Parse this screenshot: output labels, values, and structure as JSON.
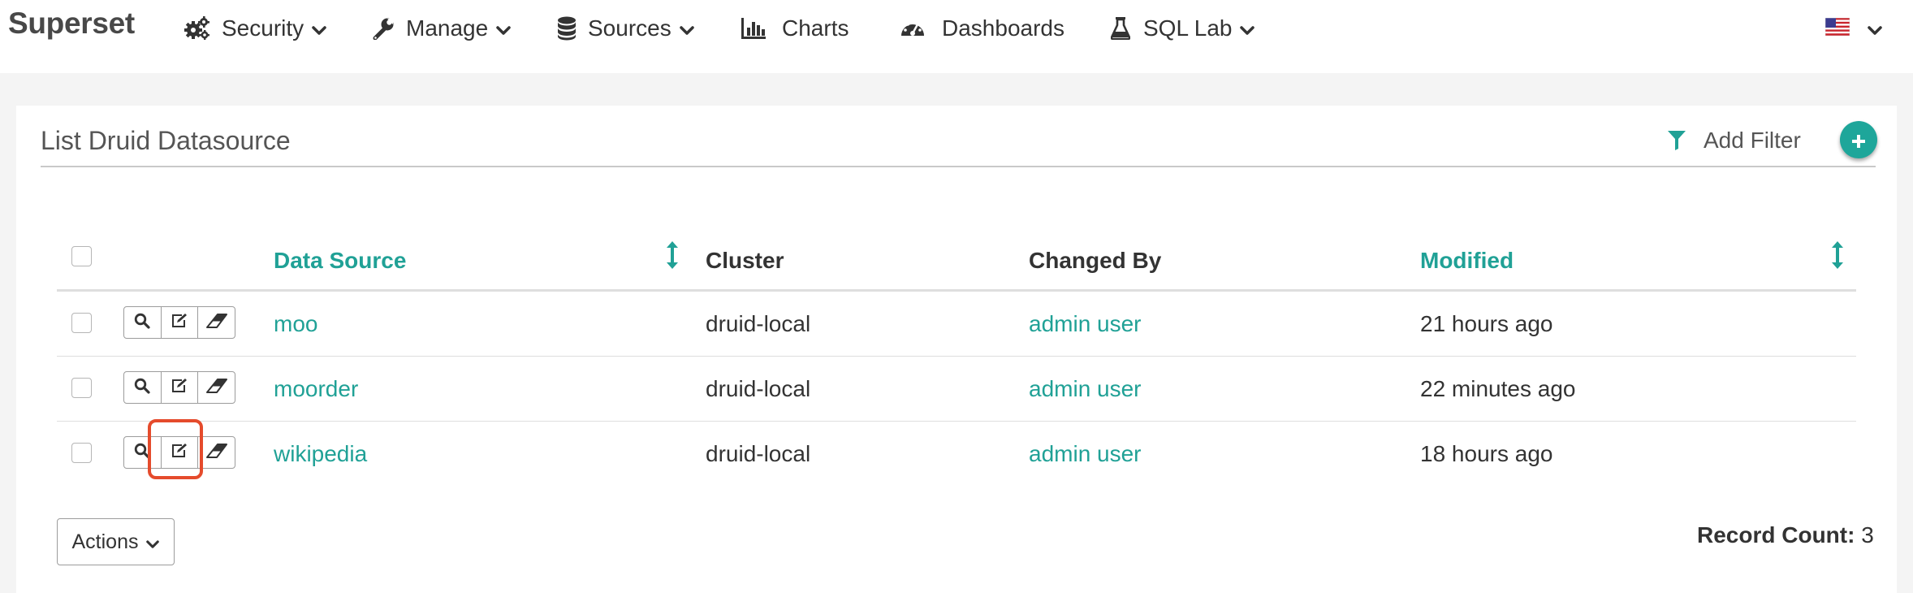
{
  "navbar": {
    "brand": "Superset",
    "items": [
      {
        "label": "Security",
        "icon": "gears-icon",
        "has_caret": true
      },
      {
        "label": "Manage",
        "icon": "wrench-icon",
        "has_caret": true
      },
      {
        "label": "Sources",
        "icon": "database-icon",
        "has_caret": true
      },
      {
        "label": "Charts",
        "icon": "bar-chart-icon",
        "has_caret": false
      },
      {
        "label": "Dashboards",
        "icon": "dashboard-gauge-icon",
        "has_caret": false
      },
      {
        "label": "SQL Lab",
        "icon": "flask-icon",
        "has_caret": true
      }
    ],
    "language_icon": "us-flag-icon"
  },
  "panel": {
    "title": "List Druid Datasource",
    "add_filter_label": "Add Filter",
    "add_button_icon": "plus-icon"
  },
  "table": {
    "columns": [
      "Data Source",
      "Cluster",
      "Changed By",
      "Modified"
    ],
    "sortable_columns": [
      "Data Source",
      "Modified"
    ],
    "rows": [
      {
        "data_source": "moo",
        "cluster": "druid-local",
        "changed_by": "admin user",
        "modified": "21 hours ago"
      },
      {
        "data_source": "moorder",
        "cluster": "druid-local",
        "changed_by": "admin user",
        "modified": "22 minutes ago"
      },
      {
        "data_source": "wikipedia",
        "cluster": "druid-local",
        "changed_by": "admin user",
        "modified": "18 hours ago"
      }
    ],
    "row_action_icons": [
      "search-icon",
      "edit-icon",
      "eraser-icon"
    ]
  },
  "footer": {
    "actions_label": "Actions",
    "record_count_label": "Record Count:",
    "record_count_value": "3"
  },
  "colors": {
    "accent": "#20a196",
    "highlight": "#e54b2c"
  }
}
